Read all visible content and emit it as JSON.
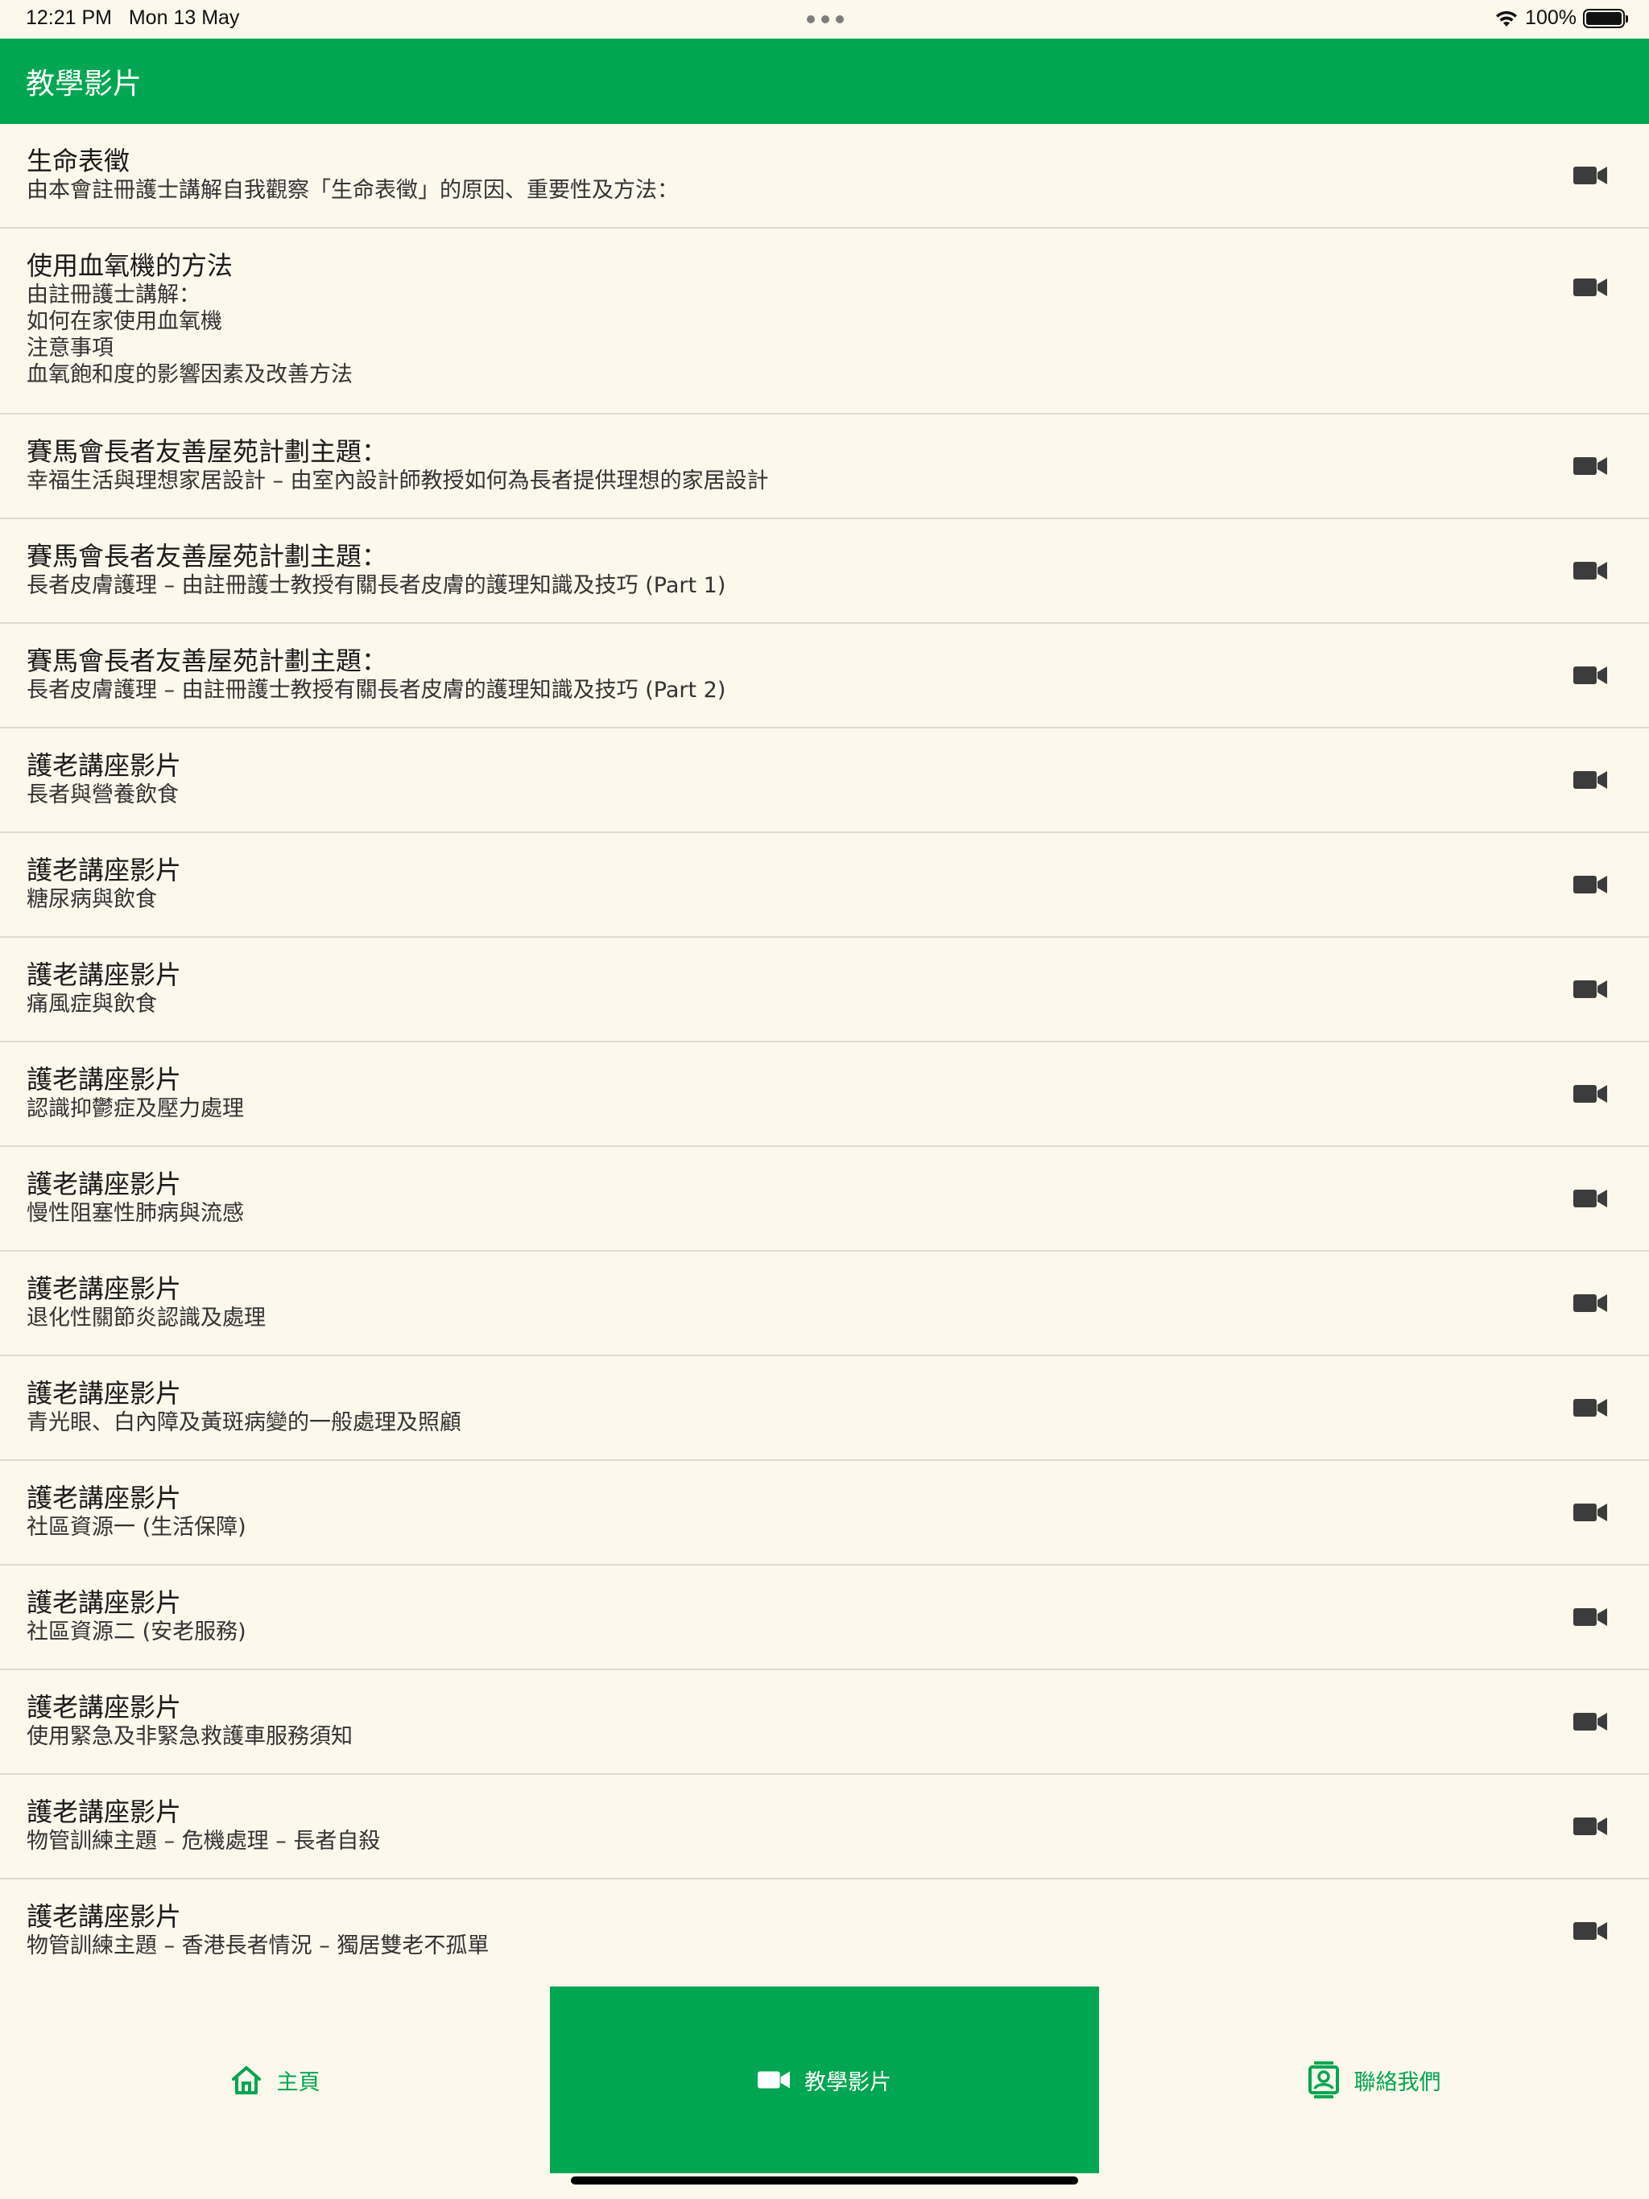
{
  "status_bar": {
    "time": "12:21 PM",
    "date": "Mon 13 May",
    "battery_percent": "100%",
    "battery_level": 1.0,
    "icons": [
      "wifi-icon",
      "battery-icon",
      "multitasking-dots-icon"
    ]
  },
  "header": {
    "title": "教學影片"
  },
  "videos": [
    {
      "title": "生命表徵",
      "description": "由本會註冊護士講解自我觀察「生命表徵」的原因、重要性及方法："
    },
    {
      "title": "使用血氧機的方法",
      "description": "由註冊護士講解：\n如何在家使用血氧機\n注意事項\n血氧飽和度的影響因素及改善方法"
    },
    {
      "title": "賽馬會長者友善屋苑計劃主題：",
      "description": "幸福生活與理想家居設計 – 由室內設計師教授如何為長者提供理想的家居設計"
    },
    {
      "title": "賽馬會長者友善屋苑計劃主題：",
      "description": "長者皮膚護理 – 由註冊護士教授有關長者皮膚的護理知識及技巧 (Part 1)"
    },
    {
      "title": "賽馬會長者友善屋苑計劃主題：",
      "description": "長者皮膚護理 – 由註冊護士教授有關長者皮膚的護理知識及技巧 (Part 2)"
    },
    {
      "title": "護老講座影片",
      "description": "長者與營養飲食"
    },
    {
      "title": "護老講座影片",
      "description": "糖尿病與飲食"
    },
    {
      "title": "護老講座影片",
      "description": "痛風症與飲食"
    },
    {
      "title": "護老講座影片",
      "description": "認識抑鬱症及壓力處理"
    },
    {
      "title": "護老講座影片",
      "description": "慢性阻塞性肺病與流感"
    },
    {
      "title": "護老講座影片",
      "description": "退化性關節炎認識及處理"
    },
    {
      "title": "護老講座影片",
      "description": "青光眼、白內障及黃斑病變的一般處理及照顧"
    },
    {
      "title": "護老講座影片",
      "description": "社區資源一 (生活保障)"
    },
    {
      "title": "護老講座影片",
      "description": "社區資源二 (安老服務)"
    },
    {
      "title": "護老講座影片",
      "description": "使用緊急及非緊急救護車服務須知"
    },
    {
      "title": "護老講座影片",
      "description": "物管訓練主題 – 危機處理 – 長者自殺"
    },
    {
      "title": "護老講座影片",
      "description": "物管訓練主題 – 香港長者情況 – 獨居雙老不孤單"
    }
  ],
  "tab_bar": {
    "home": {
      "label": "主頁",
      "icon": "home-icon"
    },
    "videos": {
      "label": "教學影片",
      "icon": "video-camera-icon",
      "active": true
    },
    "contact": {
      "label": "聯絡我們",
      "icon": "contact-card-icon"
    }
  },
  "colors": {
    "brand_green": "#00a651",
    "background": "#fdf8ec",
    "divider": "#dedbd2",
    "icon_gray": "#3c3c3c"
  }
}
